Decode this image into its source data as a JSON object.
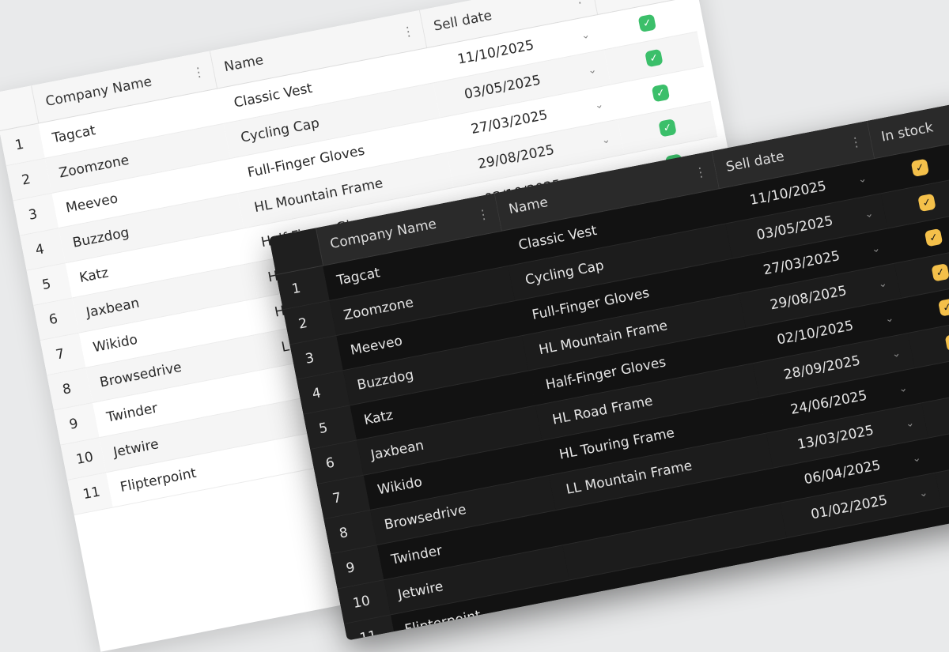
{
  "columns": {
    "company": "Company Name",
    "name": "Name",
    "sell_date": "Sell date",
    "in_stock": "In stock"
  },
  "rows": [
    {
      "index": "1",
      "company": "Tagcat",
      "name": "Classic Vest",
      "date": "11/10/2025"
    },
    {
      "index": "2",
      "company": "Zoomzone",
      "name": "Cycling Cap",
      "date": "03/05/2025"
    },
    {
      "index": "3",
      "company": "Meeveo",
      "name": "Full-Finger Gloves",
      "date": "27/03/2025"
    },
    {
      "index": "4",
      "company": "Buzzdog",
      "name": "HL Mountain Frame",
      "date": "29/08/2025"
    },
    {
      "index": "5",
      "company": "Katz",
      "name": "Half-Finger Gloves",
      "date": "02/10/2025"
    },
    {
      "index": "6",
      "company": "Jaxbean",
      "name": "HL Road Frame",
      "date": "28/09/2025"
    },
    {
      "index": "7",
      "company": "Wikido",
      "name": "HL Touring Frame",
      "date": "24/06/2025"
    },
    {
      "index": "8",
      "company": "Browsedrive",
      "name": "LL Mountain Frame",
      "date": "13/03/2025"
    },
    {
      "index": "9",
      "company": "Twinder",
      "name": "",
      "date": "06/04/2025"
    },
    {
      "index": "10",
      "company": "Jetwire",
      "name": "",
      "date": "01/02/2025"
    },
    {
      "index": "11",
      "company": "Flipterpoint",
      "name": "",
      "date": ""
    }
  ],
  "icons": {
    "column_menu": "kebab-menu-icon",
    "row_expand": "chevron-down-icon",
    "in_stock": "check-icon"
  },
  "colors": {
    "light_check": "#3bbf6a",
    "dark_check": "#f4c04a",
    "dark_bg": "#161616"
  }
}
